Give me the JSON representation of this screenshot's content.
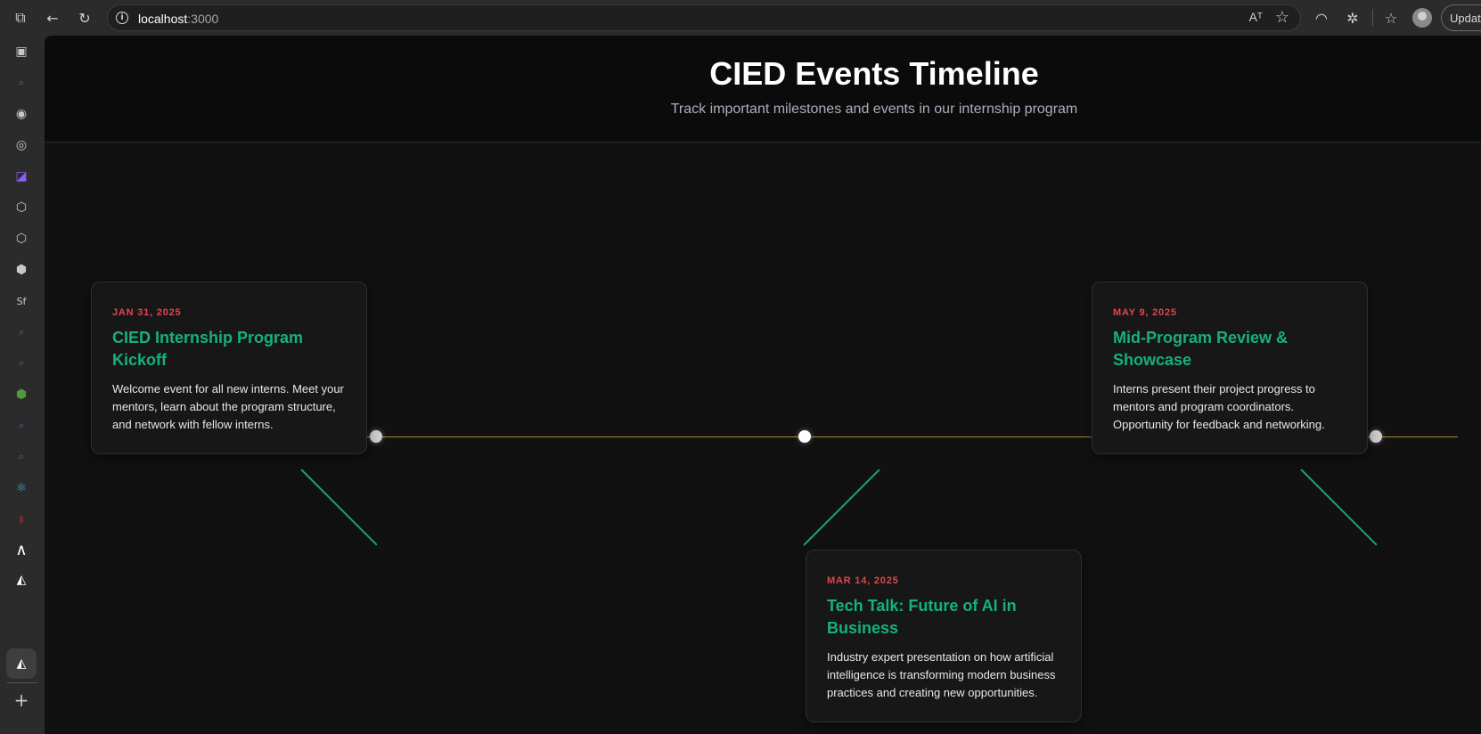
{
  "browser": {
    "url_host": "localhost",
    "url_port": ":3000",
    "read_aloud_label": "Aᵀ",
    "update_label": "Update"
  },
  "page": {
    "title": "CIED Events Timeline",
    "subtitle": "Track important milestones and events in our internship program"
  },
  "events": [
    {
      "date": "JAN 31, 2025",
      "title": "CIED Internship Program Kickoff",
      "description": "Welcome event for all new interns. Meet your mentors, learn about the program structure, and network with fellow interns."
    },
    {
      "date": "MAR 14, 2025",
      "title": "Tech Talk: Future of AI in Business",
      "description": "Industry expert presentation on how artificial intelligence is transforming modern business practices and creating new opportunities."
    },
    {
      "date": "MAY 9, 2025",
      "title": "Mid-Program Review & Showcase",
      "description": "Interns present their project progress to mentors and program coordinators. Opportunity for feedback and networking."
    }
  ],
  "partial_label": "date",
  "colors": {
    "accent_green": "#16b07f",
    "date_red": "#e0464c",
    "timeline_gold": "#b08a2e"
  }
}
